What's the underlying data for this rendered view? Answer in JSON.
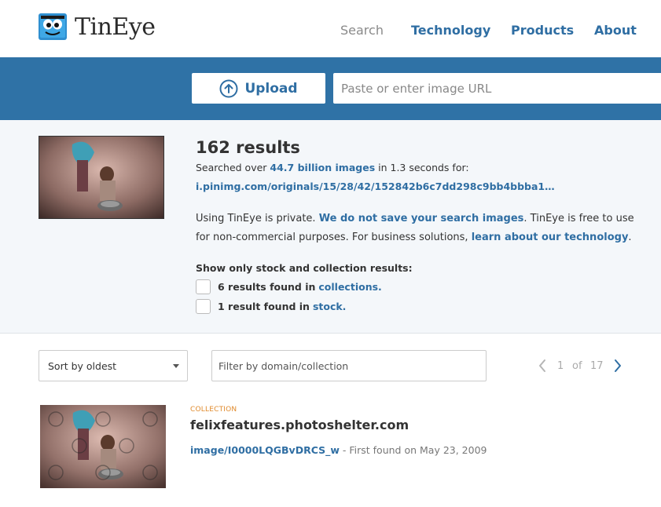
{
  "header": {
    "logo_text": "TinEye",
    "nav": {
      "search": "Search",
      "technology": "Technology",
      "products": "Products",
      "about": "About"
    }
  },
  "searchbar": {
    "upload_label": "Upload",
    "url_placeholder": "Paste or enter image URL"
  },
  "summary": {
    "results_title": "162 results",
    "searched_prefix": "Searched over",
    "searched_link": "44.7 billion images",
    "searched_suffix": "in 1.3 seconds for:",
    "query_url": "i.pinimg.com/originals/15/28/42/152842b6c7dd298c9bb4bbba1…",
    "privacy_1": "Using TinEye is private.",
    "privacy_link_1": "We do not save your search images",
    "privacy_2": ". TinEye is free to use for non-commercial purposes. For business solutions,",
    "privacy_link_2": "learn about our technology",
    "privacy_3": ".",
    "filter_heading": "Show only stock and collection results:",
    "filters": [
      {
        "count_text": "6 results found in",
        "link": "collections."
      },
      {
        "count_text": "1 result found in",
        "link": "stock."
      }
    ]
  },
  "controls": {
    "sort_value": "Sort by oldest",
    "filter_placeholder": "Filter by domain/collection",
    "pager": {
      "current": "1",
      "of": "of",
      "total": "17"
    }
  },
  "results": [
    {
      "tag": "COLLECTION",
      "domain": "felixfeatures.photoshelter.com",
      "link": "image/I0000LQGBvDRCS_w",
      "found": " - First found on May 23, 2009"
    }
  ],
  "colors": {
    "brand_blue": "#2f72a6",
    "link_blue": "#2f6ea3",
    "collection_orange": "#e08a2c"
  }
}
